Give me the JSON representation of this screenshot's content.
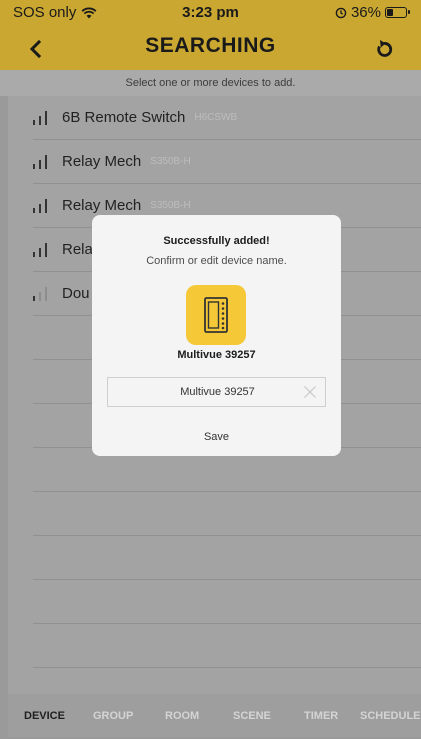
{
  "status_bar": {
    "carrier": "SOS only",
    "time": "3:23 pm",
    "battery": "36%",
    "battery_level": 0.36,
    "icons": [
      "wifi-icon",
      "alarm-icon",
      "battery-icon"
    ]
  },
  "nav": {
    "title": "SEARCHING",
    "back_icon": "chevron-left-icon",
    "refresh_icon": "refresh-icon"
  },
  "subtitle": "Select one or more devices to add.",
  "devices": [
    {
      "name": "6B Remote Switch",
      "model": "H6CSWB",
      "signal": "strong"
    },
    {
      "name": "Relay Mech",
      "model": "S350B-H",
      "signal": "strong"
    },
    {
      "name": "Relay Mech",
      "model": "S350B-H",
      "signal": "strong"
    },
    {
      "name": "Rela",
      "model": "",
      "signal": "strong"
    },
    {
      "name": "Dou",
      "model": "",
      "signal": "weak"
    }
  ],
  "tabs": [
    {
      "label": "DEVICE",
      "active": true
    },
    {
      "label": "GROUP",
      "active": false
    },
    {
      "label": "ROOM",
      "active": false
    },
    {
      "label": "SCENE",
      "active": false
    },
    {
      "label": "TIMER",
      "active": false
    },
    {
      "label": "SCHEDULE",
      "active": false
    }
  ],
  "modal": {
    "title": "Successfully added!",
    "subtitle": "Confirm or edit device name.",
    "device_icon": "wall-switch-icon",
    "device_name": "Multivue 39257",
    "input_value": "Multivue 39257",
    "save_label": "Save"
  },
  "colors": {
    "header": "#f5cf3f",
    "device_icon_bg": "#f5c838",
    "modal_bg": "#f4f4f4"
  }
}
